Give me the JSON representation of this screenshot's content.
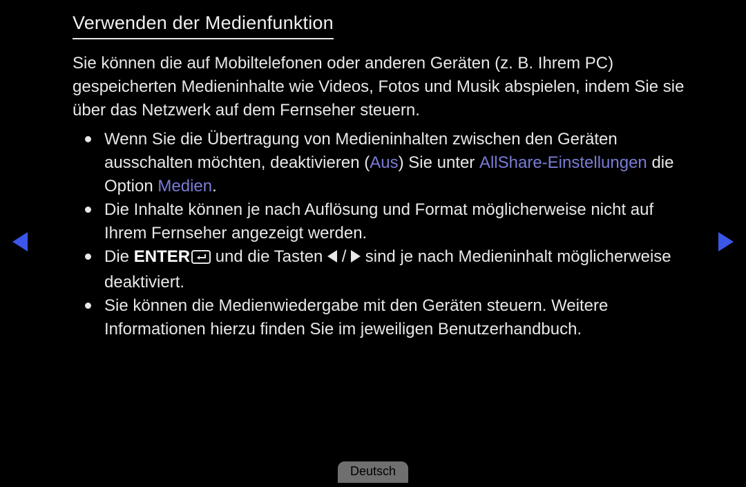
{
  "title": "Verwenden der Medienfunktion",
  "intro": "Sie können die auf Mobiltelefonen oder anderen Geräten (z. B. Ihrem PC) gespeicherten Medieninhalte wie Videos, Fotos und Musik abspielen, indem Sie sie über das Netzwerk auf dem Fernseher steuern.",
  "bullets": {
    "b1a": "Wenn Sie die Übertragung von Medieninhalten zwischen den Geräten ausschalten möchten, deaktivieren (",
    "b1_aus": "Aus",
    "b1b": ") Sie unter ",
    "b1_allshare": "AllShare-Einstellungen",
    "b1c": " die Option ",
    "b1_medien": "Medien",
    "b1d": ".",
    "b2": "Die Inhalte können je nach Auflösung und Format möglicherweise nicht auf Ihrem Fernseher angezeigt werden.",
    "b3a": "Die ",
    "b3_enter": "ENTER",
    "b3b": " und die Tasten ",
    "b3_slash": " / ",
    "b3c": " sind je nach Medieninhalt möglicherweise deaktiviert.",
    "b4": "Sie können die Medienwiedergabe mit den Geräten steuern. Weitere Informationen hierzu finden Sie im jeweiligen Benutzerhandbuch."
  },
  "language": "Deutsch"
}
